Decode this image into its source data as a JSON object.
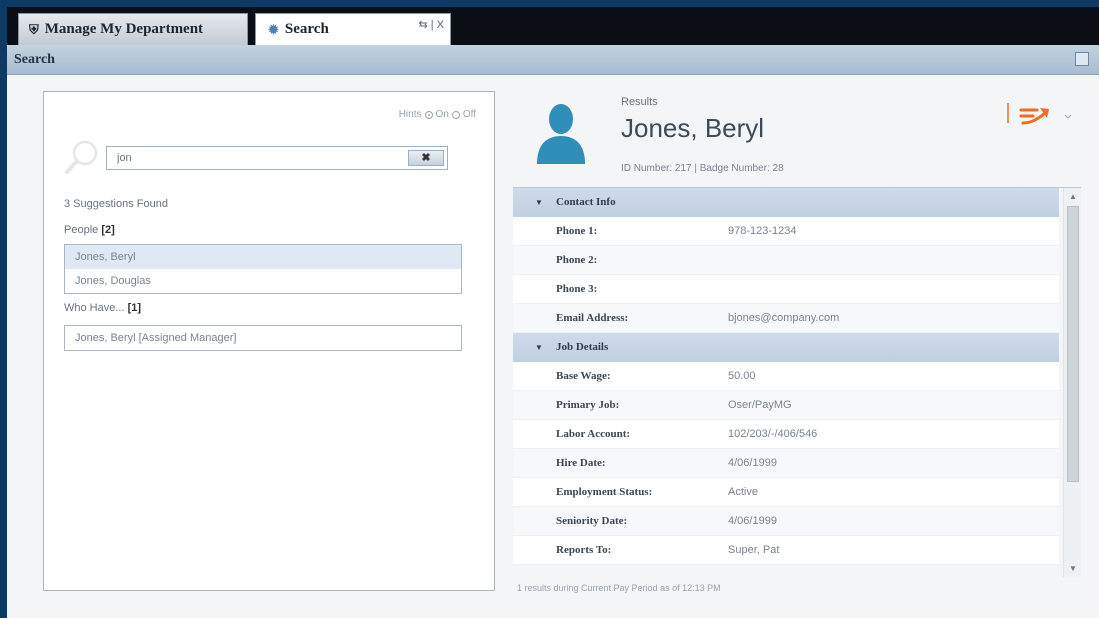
{
  "tabs": [
    {
      "label": "Manage My Department",
      "icon": "home-icon"
    },
    {
      "label": "Search",
      "icon": "search-tab-icon"
    }
  ],
  "tab_controls": "⇆ | X",
  "panel_title": "Search",
  "hints": {
    "label": "Hints",
    "on": "On",
    "off": "Off",
    "selected": "On"
  },
  "search": {
    "value": "jon",
    "clear_label": "✖"
  },
  "suggestions": {
    "count_text": "3 Suggestions Found",
    "people_title": "People",
    "people_count": "[2]",
    "people": [
      "Jones, Beryl",
      "Jones, Douglas"
    ],
    "selected": "Jones, Beryl",
    "who_have_title": "Who Have...",
    "who_have_count": "[1]",
    "who_have": [
      "Jones, Beryl [Assigned Manager]"
    ]
  },
  "results": {
    "label": "Results",
    "name": "Jones, Beryl",
    "ids": "ID Number: 217 | Badge Number: 28"
  },
  "sections": [
    {
      "title": "Contact Info",
      "rows": [
        {
          "label": "Phone 1:",
          "value": "978-123-1234"
        },
        {
          "label": "Phone 2:",
          "value": ""
        },
        {
          "label": "Phone 3:",
          "value": ""
        },
        {
          "label": "Email Address:",
          "value": "bjones@company.com"
        }
      ]
    },
    {
      "title": "Job Details",
      "rows": [
        {
          "label": "Base Wage:",
          "value": "50.00"
        },
        {
          "label": "Primary Job:",
          "value": "Oser/PayMG"
        },
        {
          "label": "Labor Account:",
          "value": "102/203/-/406/546"
        },
        {
          "label": "Hire Date:",
          "value": "4/06/1999"
        },
        {
          "label": "Employment Status:",
          "value": "Active"
        },
        {
          "label": "Seniority Date:",
          "value": "4/06/1999"
        },
        {
          "label": "Reports To:",
          "value": "Super, Pat"
        }
      ]
    }
  ],
  "footer": "1 results during Current Pay Period as of 12:13 PM",
  "colors": {
    "accent": "#f26b21",
    "header_bg": "#c4d2e1",
    "avatar": "#2f8fb8",
    "selected_row": "#dfe8f3"
  }
}
